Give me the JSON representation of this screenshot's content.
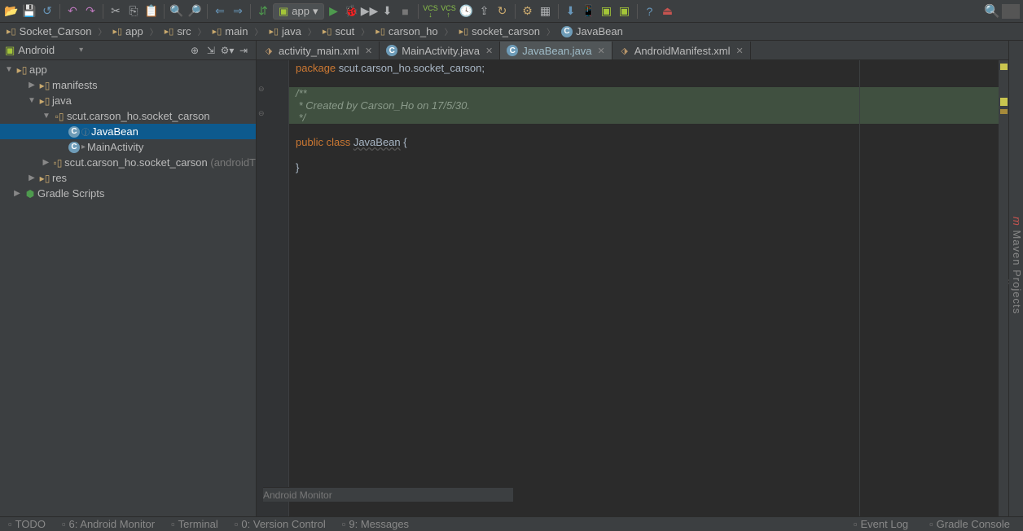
{
  "run_config": "app",
  "breadcrumbs": [
    {
      "label": "Socket_Carson",
      "icon": "folder"
    },
    {
      "label": "app",
      "icon": "folder"
    },
    {
      "label": "src",
      "icon": "folder"
    },
    {
      "label": "main",
      "icon": "folder"
    },
    {
      "label": "java",
      "icon": "folder"
    },
    {
      "label": "scut",
      "icon": "folder"
    },
    {
      "label": "carson_ho",
      "icon": "folder"
    },
    {
      "label": "socket_carson",
      "icon": "folder"
    },
    {
      "label": "JavaBean",
      "icon": "class"
    }
  ],
  "project_view": "Android",
  "tree": {
    "root": "app",
    "nodes": [
      {
        "depth": 1,
        "label": "manifests",
        "arrow": "right",
        "icon": "folder"
      },
      {
        "depth": 1,
        "label": "java",
        "arrow": "down",
        "icon": "folder"
      },
      {
        "depth": 2,
        "label": "scut.carson_ho.socket_carson",
        "arrow": "down",
        "icon": "package"
      },
      {
        "depth": 3,
        "label": "JavaBean",
        "icon": "class",
        "selected": true,
        "small": "ⓙ"
      },
      {
        "depth": 3,
        "label": "MainActivity",
        "icon": "class",
        "small": "▸"
      },
      {
        "depth": 2,
        "label": "scut.carson_ho.socket_carson",
        "suffix": "(androidT",
        "arrow": "right",
        "icon": "package"
      },
      {
        "depth": 1,
        "label": "res",
        "arrow": "right",
        "icon": "folder-res"
      },
      {
        "depth": 0,
        "label": "Gradle Scripts",
        "arrow": "right",
        "icon": "gradle"
      }
    ]
  },
  "tabs": [
    {
      "label": "activity_main.xml",
      "icon": "xml",
      "active": false
    },
    {
      "label": "MainActivity.java",
      "icon": "class",
      "active": false
    },
    {
      "label": "JavaBean.java",
      "icon": "class",
      "active": true
    },
    {
      "label": "AndroidManifest.xml",
      "icon": "xml",
      "active": false
    }
  ],
  "code": {
    "package_kw": "package",
    "package_name": " scut.carson_ho.socket_carson;",
    "comment_open": "/**",
    "comment_body": " * Created by Carson_Ho on 17/5/30.",
    "comment_close": " */",
    "pub_kw": "public ",
    "class_kw": "class ",
    "class_name": "JavaBean",
    "brace_open": " {",
    "brace_close": "}"
  },
  "status_label": "Android Monitor",
  "footer_tabs": [
    "TODO",
    "6: Android Monitor",
    "Terminal",
    "0: Version Control",
    "9: Messages"
  ],
  "footer_right": [
    "Event Log",
    "Gradle Console"
  ]
}
